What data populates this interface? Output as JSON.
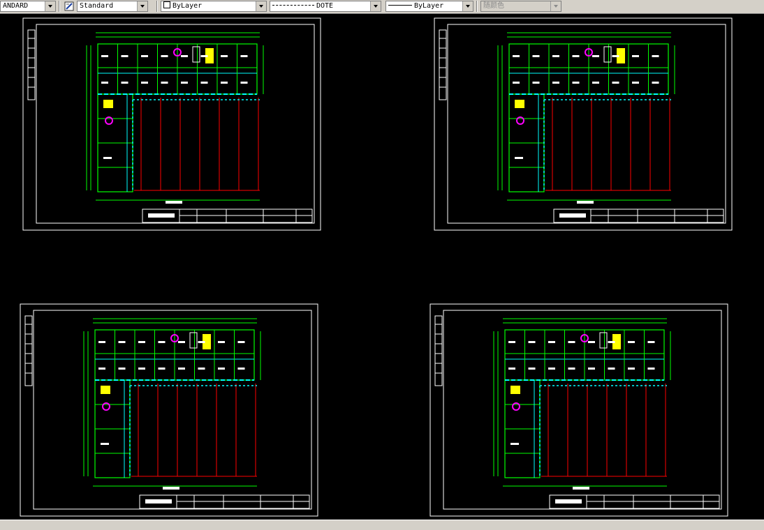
{
  "toolbar": {
    "text_style": "ANDARD",
    "dim_style": "Standard",
    "layer": "ByLayer",
    "linetype": "DOTE",
    "lineweight": "ByLayer",
    "plot_color": "随颜色"
  },
  "colors": {
    "background": "#000000",
    "frame": "#ffffff",
    "wall": "#00ff00",
    "window": "#00ffff",
    "grid": "#ff0000",
    "stair": "#ffff00",
    "fixture": "#ff00ff"
  },
  "sheets": [
    {
      "id": "sheet-1"
    },
    {
      "id": "sheet-2"
    },
    {
      "id": "sheet-3"
    },
    {
      "id": "sheet-4"
    }
  ]
}
